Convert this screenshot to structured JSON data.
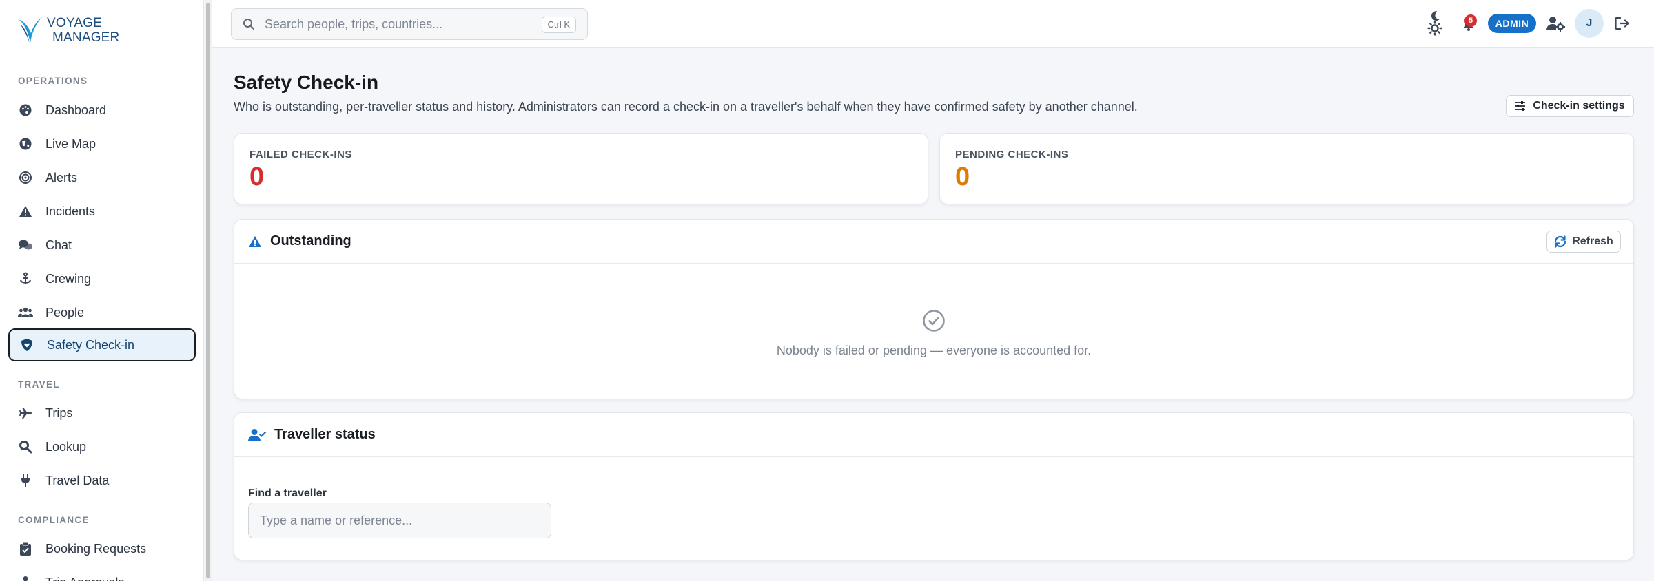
{
  "app": {
    "logo_line1": "VOYAGE",
    "logo_line2": "MANAGER"
  },
  "sidebar": {
    "sections": [
      {
        "label": "OPERATIONS"
      },
      {
        "label": "TRAVEL"
      },
      {
        "label": "COMPLIANCE"
      }
    ],
    "items": [
      {
        "label": "Dashboard",
        "icon": "palette-icon"
      },
      {
        "label": "Live Map",
        "icon": "globe-icon"
      },
      {
        "label": "Alerts",
        "icon": "target-icon"
      },
      {
        "label": "Incidents",
        "icon": "warning-icon"
      },
      {
        "label": "Chat",
        "icon": "chat-icon"
      },
      {
        "label": "Crewing",
        "icon": "anchor-icon"
      },
      {
        "label": "People",
        "icon": "people-icon"
      },
      {
        "label": "Safety Check-in",
        "icon": "shield-heart-icon",
        "active": true
      },
      {
        "label": "Trips",
        "icon": "plane-icon"
      },
      {
        "label": "Lookup",
        "icon": "magnifier-icon"
      },
      {
        "label": "Travel Data",
        "icon": "plug-icon"
      },
      {
        "label": "Booking Requests",
        "icon": "clipboard-icon"
      },
      {
        "label": "Trip Approvals",
        "icon": "stamp-icon"
      }
    ]
  },
  "topbar": {
    "search_placeholder": "Search people, trips, countries...",
    "search_shortcut": "Ctrl K",
    "notification_count": "5",
    "role_badge": "ADMIN",
    "avatar_initial": "J"
  },
  "page": {
    "title": "Safety Check-in",
    "subtitle": "Who is outstanding, per-traveller status and history. Administrators can record a check-in on a traveller's behalf when they have confirmed safety by another channel.",
    "settings_button": "Check-in settings"
  },
  "stats": {
    "failed_label": "FAILED CHECK-INS",
    "failed_value": "0",
    "pending_label": "PENDING CHECK-INS",
    "pending_value": "0"
  },
  "outstanding": {
    "title": "Outstanding",
    "refresh_label": "Refresh",
    "empty_message": "Nobody is failed or pending — everyone is accounted for."
  },
  "traveller_status": {
    "title": "Traveller status",
    "field_label": "Find a traveller",
    "field_placeholder": "Type a name or reference..."
  },
  "colors": {
    "accent": "#1670c8",
    "failed": "#d32f2f",
    "pending": "#e07b00",
    "active_nav_bg": "#e8f2fb"
  }
}
